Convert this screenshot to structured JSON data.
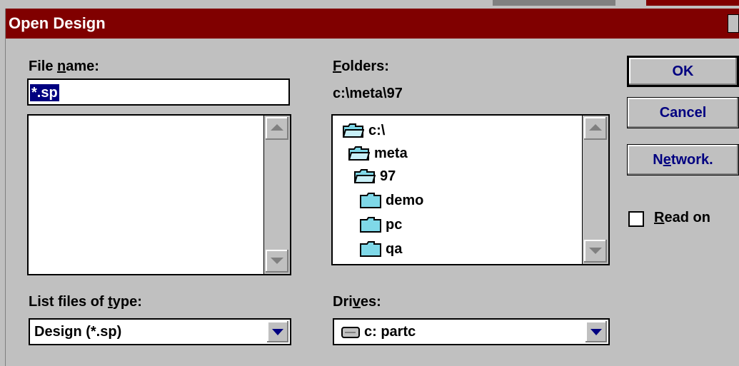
{
  "window": {
    "title": "Open Design"
  },
  "file_name": {
    "label_pre": "File ",
    "label_ul": "n",
    "label_post": "ame:",
    "value": "*.sp",
    "files": []
  },
  "folders": {
    "label_ul": "F",
    "label_post": "olders:",
    "current_path": "c:\\meta\\97",
    "items": [
      {
        "label": "c:\\",
        "icon": "open-folder-icon"
      },
      {
        "label": "meta",
        "icon": "open-folder-icon"
      },
      {
        "label": "97",
        "icon": "open-folder-icon"
      },
      {
        "label": "demo",
        "icon": "folder-icon"
      },
      {
        "label": "pc",
        "icon": "folder-icon"
      },
      {
        "label": "qa",
        "icon": "folder-icon"
      }
    ]
  },
  "file_type": {
    "label_pre": "List files of ",
    "label_ul": "t",
    "label_post": "ype:",
    "selected": "Design (*.sp)"
  },
  "drives": {
    "label_pre": "Dri",
    "label_ul": "v",
    "label_post": "es:",
    "selected": "c: partc",
    "icon": "drive-icon"
  },
  "buttons": {
    "ok": "OK",
    "cancel": "Cancel",
    "network_pre": "N",
    "network_ul": "e",
    "network_post": "twork."
  },
  "read_only": {
    "label_ul": "R",
    "label_post": "ead on",
    "checked": false
  },
  "colors": {
    "title_bar": "#800000",
    "selection": "#000080",
    "button_text": "#000080",
    "folder_fill": "#7fd8e8"
  }
}
